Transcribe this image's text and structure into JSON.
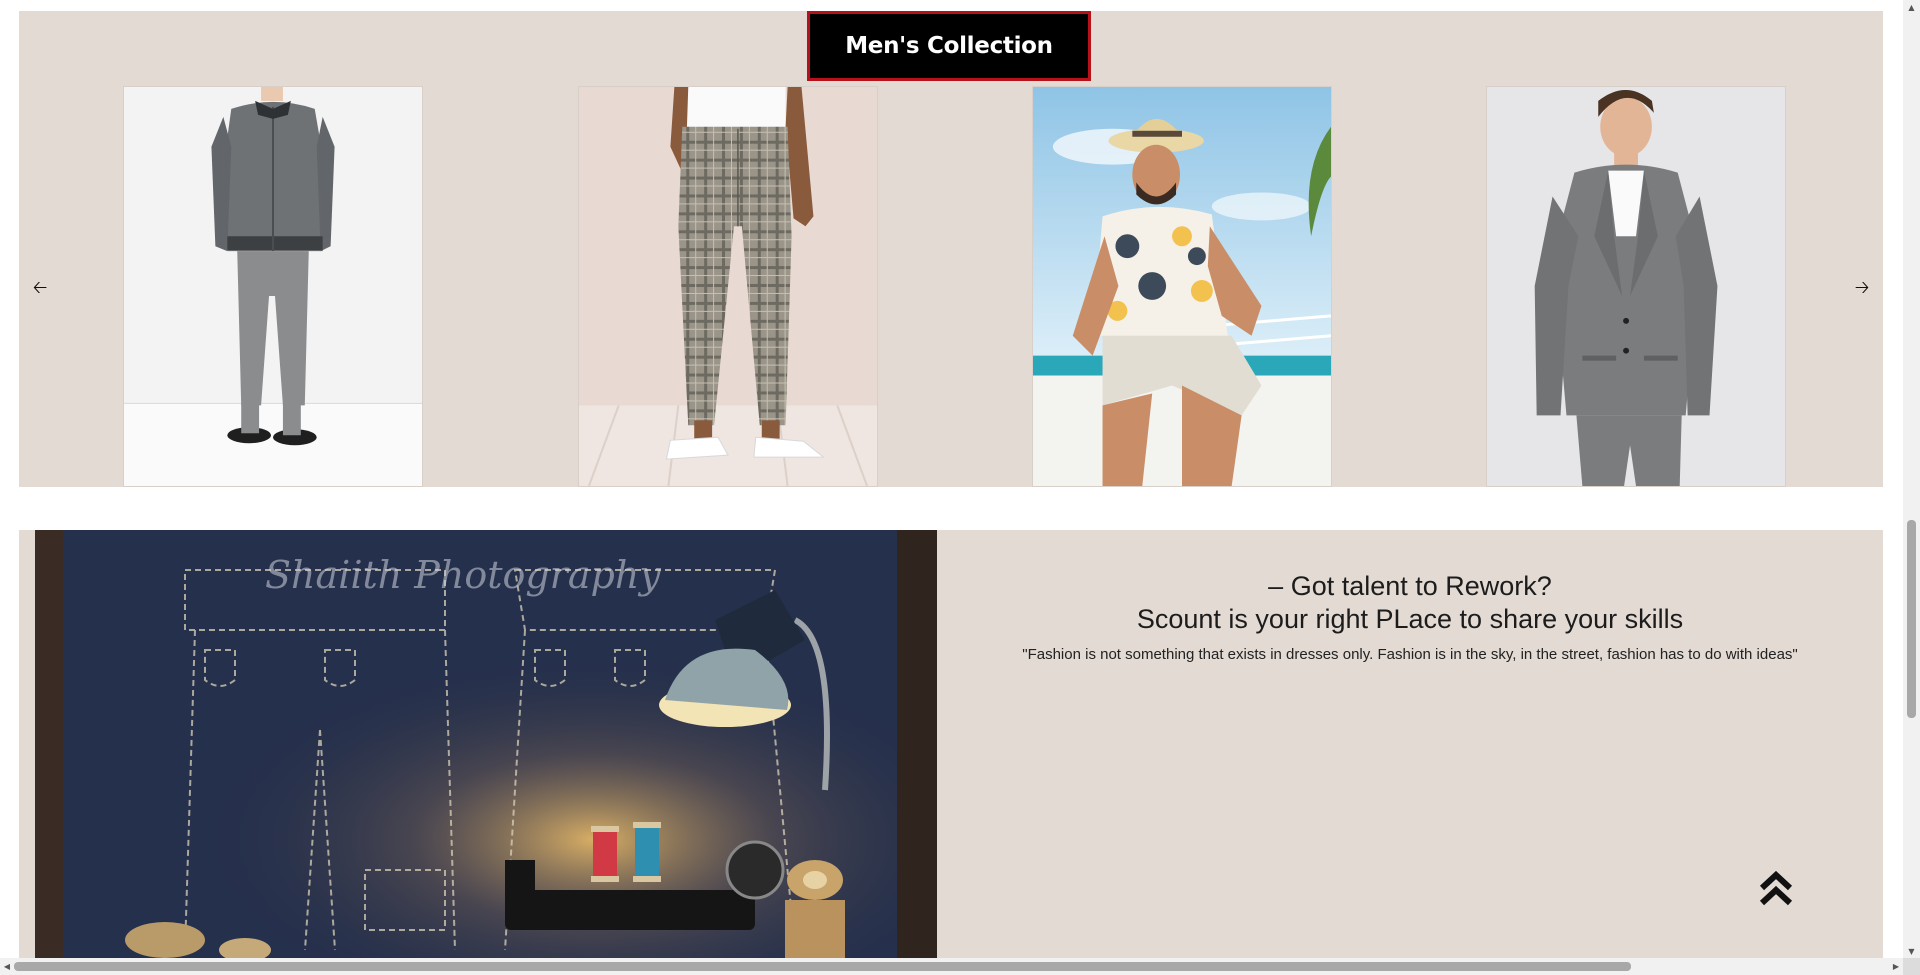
{
  "collection": {
    "title": "Men's Collection",
    "prev_arrow": "🡠",
    "next_arrow": "🡢"
  },
  "talent": {
    "heading_line1": "– Got talent to Rework?",
    "heading_line2": "Scount is your right PLace to share your skills",
    "quote": "\"Fashion is not something that exists in dresses only. Fashion is in the sky, in the street, fashion has to do with ideas\"",
    "image_caption": "Shaiith Photography"
  },
  "scrollbar": {
    "up": "▲",
    "down": "▼",
    "left": "◀",
    "right": "▶"
  }
}
